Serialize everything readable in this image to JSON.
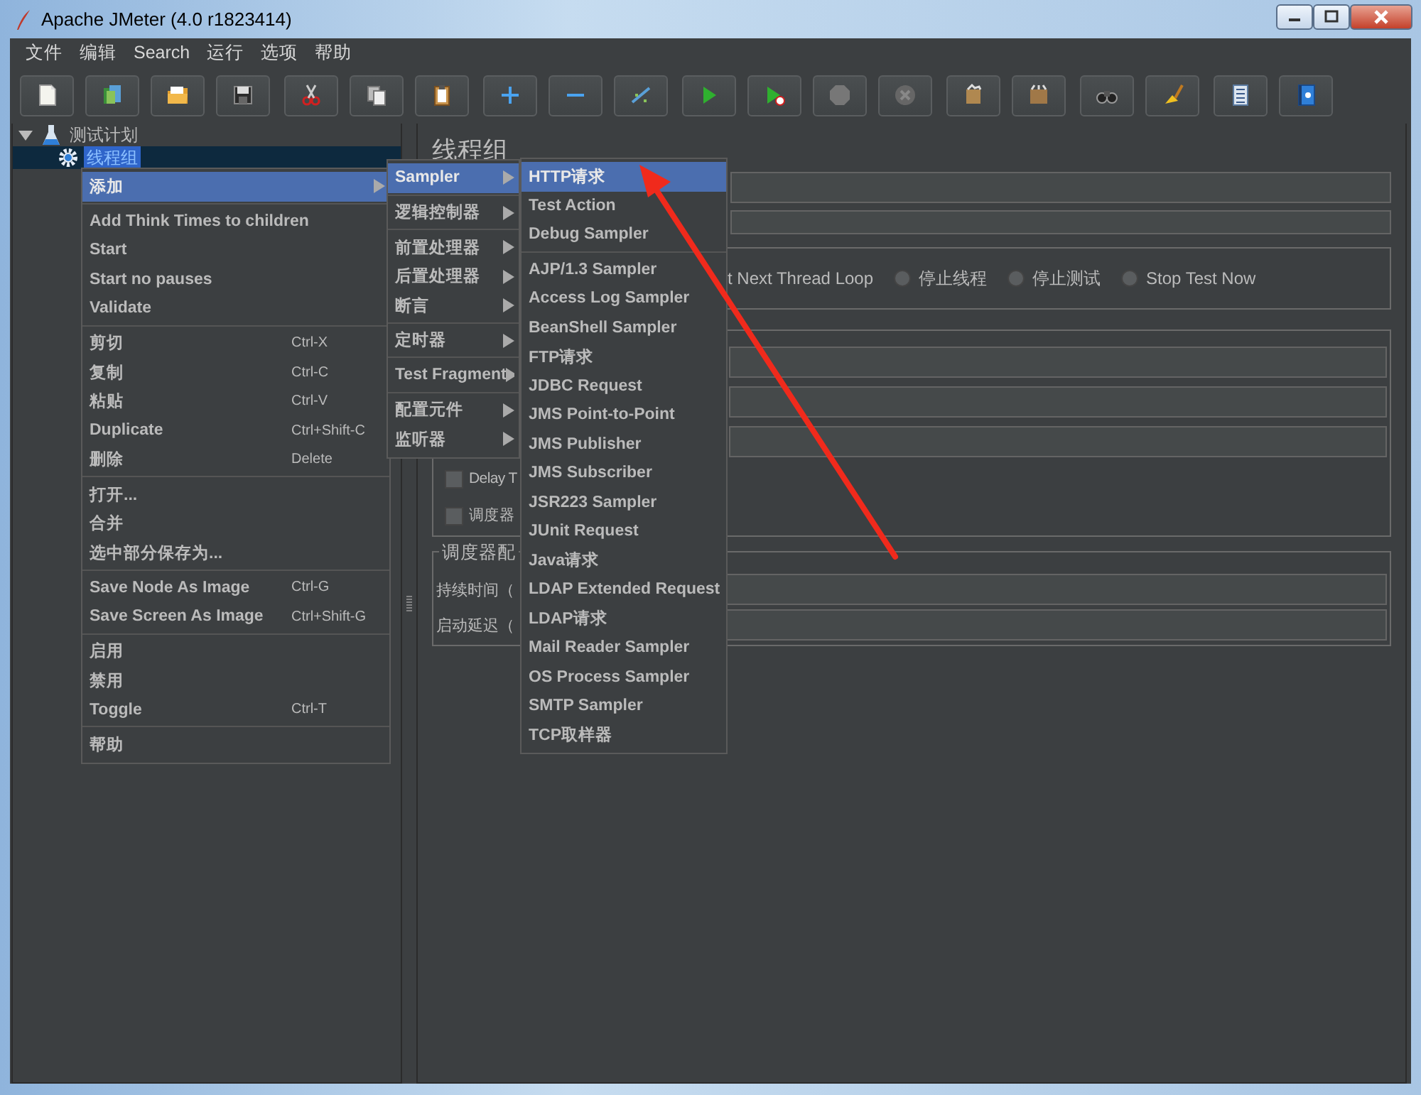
{
  "window": {
    "title": "Apache JMeter (4.0 r1823414)"
  },
  "menu_bar": [
    "文件",
    "编辑",
    "Search",
    "运行",
    "选项",
    "帮助"
  ],
  "tree": [
    {
      "label": "测试计划",
      "expanded": true,
      "selected": false,
      "children": [
        {
          "label": "线程组",
          "selected": true
        }
      ]
    }
  ],
  "panel": {
    "title": "线程组",
    "error_actions": [
      {
        "label": "t Next Thread Loop"
      },
      {
        "label": "停止线程",
        "selected": false
      },
      {
        "label": "停止测试",
        "selected": false
      },
      {
        "label": "Stop Test Now",
        "selected": false
      }
    ],
    "checkboxes": [
      {
        "label": "Delay T",
        "checked": false
      },
      {
        "label": "调度器",
        "checked": false
      }
    ],
    "scheduler": {
      "title": "调度器配",
      "fields": [
        {
          "label": "持续时间（"
        },
        {
          "label": "启动延迟（"
        }
      ]
    }
  },
  "context_menu": {
    "groups": [
      [
        {
          "label": "添加",
          "selected": true,
          "submenu": true
        }
      ],
      [
        {
          "label": "Add Think Times to children",
          "selected": false
        },
        {
          "label": "Start",
          "selected": false
        },
        {
          "label": "Start no pauses",
          "selected": false
        },
        {
          "label": "Validate",
          "selected": false
        }
      ],
      [
        {
          "label": "剪切",
          "shortcut": "Ctrl-X",
          "selected": false
        },
        {
          "label": "复制",
          "shortcut": "Ctrl-C",
          "selected": false
        },
        {
          "label": "粘贴",
          "shortcut": "Ctrl-V",
          "selected": false
        },
        {
          "label": "Duplicate",
          "shortcut": "Ctrl+Shift-C",
          "selected": false
        },
        {
          "label": "删除",
          "shortcut": "Delete",
          "selected": false
        }
      ],
      [
        {
          "label": "打开...",
          "selected": false
        },
        {
          "label": "合并",
          "selected": false
        },
        {
          "label": "选中部分保存为...",
          "selected": false
        }
      ],
      [
        {
          "label": "Save Node As Image",
          "shortcut": "Ctrl-G",
          "selected": false
        },
        {
          "label": "Save Screen As Image",
          "shortcut": "Ctrl+Shift-G",
          "selected": false
        }
      ],
      [
        {
          "label": "启用",
          "selected": false
        },
        {
          "label": "禁用",
          "selected": false
        },
        {
          "label": "Toggle",
          "shortcut": "Ctrl-T",
          "selected": false
        }
      ],
      [
        {
          "label": "帮助",
          "selected": false
        }
      ]
    ]
  },
  "add_menu": {
    "groups": [
      [
        {
          "label": "Sampler",
          "selected": true,
          "submenu": true
        }
      ],
      [
        {
          "label": "逻辑控制器",
          "selected": false,
          "submenu": true
        }
      ],
      [
        {
          "label": "前置处理器",
          "selected": false,
          "submenu": true
        },
        {
          "label": "后置处理器",
          "selected": false,
          "submenu": true
        },
        {
          "label": "断言",
          "selected": false,
          "submenu": true
        }
      ],
      [
        {
          "label": "定时器",
          "selected": false,
          "submenu": true
        }
      ],
      [
        {
          "label": "Test Fragment",
          "selected": false,
          "submenu": true
        }
      ],
      [
        {
          "label": "配置元件",
          "selected": false,
          "submenu": true
        },
        {
          "label": "监听器",
          "selected": false,
          "submenu": true
        }
      ]
    ]
  },
  "sampler_menu": {
    "groups": [
      [
        {
          "label": "HTTP请求",
          "selected": true
        },
        {
          "label": "Test Action",
          "selected": false
        },
        {
          "label": "Debug Sampler",
          "selected": false
        }
      ],
      [
        {
          "label": "AJP/1.3 Sampler",
          "selected": false
        },
        {
          "label": "Access Log Sampler",
          "selected": false
        },
        {
          "label": "BeanShell Sampler",
          "selected": false
        },
        {
          "label": "FTP请求",
          "selected": false
        },
        {
          "label": "JDBC Request",
          "selected": false
        },
        {
          "label": "JMS Point-to-Point",
          "selected": false
        },
        {
          "label": "JMS Publisher",
          "selected": false
        },
        {
          "label": "JMS Subscriber",
          "selected": false
        },
        {
          "label": "JSR223 Sampler",
          "selected": false
        },
        {
          "label": "JUnit Request",
          "selected": false
        },
        {
          "label": "Java请求",
          "selected": false
        },
        {
          "label": "LDAP Extended Request",
          "selected": false
        },
        {
          "label": "LDAP请求",
          "selected": false
        },
        {
          "label": "Mail Reader Sampler",
          "selected": false
        },
        {
          "label": "OS Process Sampler",
          "selected": false
        },
        {
          "label": "SMTP Sampler",
          "selected": false
        },
        {
          "label": "TCP取样器",
          "selected": false
        }
      ]
    ]
  }
}
